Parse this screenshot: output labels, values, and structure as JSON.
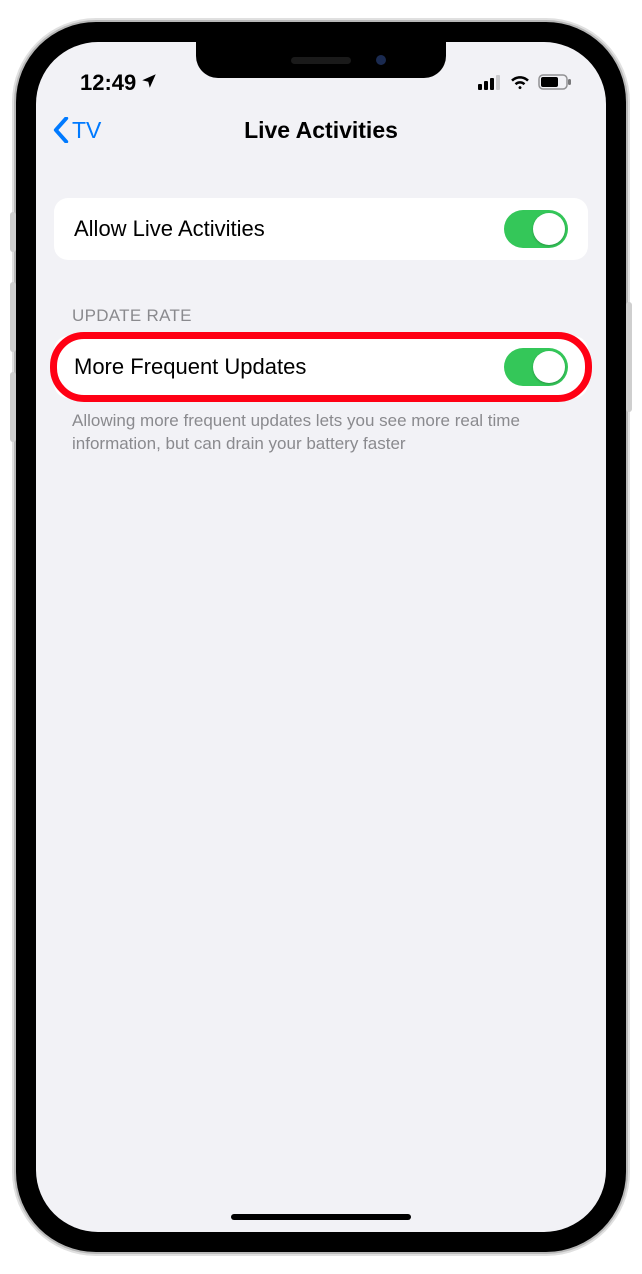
{
  "status": {
    "time": "12:49",
    "location_icon": "location-arrow",
    "signal_icon": "cellular-signal",
    "wifi_icon": "wifi",
    "battery_icon": "battery"
  },
  "nav": {
    "back_label": "TV",
    "title": "Live Activities"
  },
  "rows": {
    "allow": {
      "label": "Allow Live Activities",
      "on": true
    },
    "section_header": "UPDATE RATE",
    "frequent": {
      "label": "More Frequent Updates",
      "on": true
    },
    "footer": "Allowing more frequent updates lets you see more real time information, but can drain your battery faster"
  },
  "colors": {
    "accent": "#007aff",
    "toggle_on": "#34c759",
    "highlight": "#ff0014"
  }
}
